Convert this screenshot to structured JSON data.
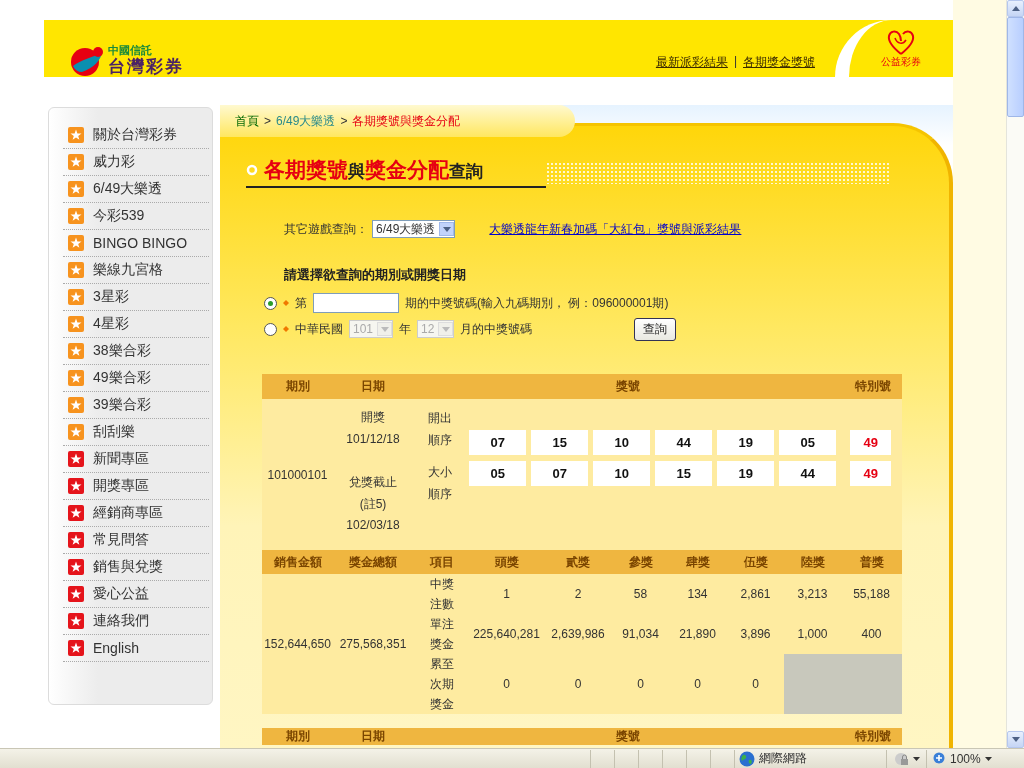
{
  "header": {
    "brand_top": "中國信託",
    "brand": "台灣彩券",
    "links": [
      "最新派彩結果",
      "各期獎金獎號"
    ],
    "link_separator": "|",
    "charity_label": "公益彩券"
  },
  "sidebar": {
    "items": [
      {
        "label": "關於台灣彩券",
        "color": "#f7931e"
      },
      {
        "label": "威力彩",
        "color": "#f7931e"
      },
      {
        "label": "6/49大樂透",
        "color": "#f7931e"
      },
      {
        "label": "今彩539",
        "color": "#f7931e"
      },
      {
        "label": "BINGO BINGO",
        "color": "#f7931e"
      },
      {
        "label": "樂線九宮格",
        "color": "#f7931e"
      },
      {
        "label": "3星彩",
        "color": "#f7931e"
      },
      {
        "label": "4星彩",
        "color": "#f7931e"
      },
      {
        "label": "38樂合彩",
        "color": "#f7931e"
      },
      {
        "label": "49樂合彩",
        "color": "#f7931e"
      },
      {
        "label": "39樂合彩",
        "color": "#f7931e"
      },
      {
        "label": "刮刮樂",
        "color": "#f7931e"
      },
      {
        "label": "新聞專區",
        "color": "#e5141b"
      },
      {
        "label": "開獎專區",
        "color": "#e5141b"
      },
      {
        "label": "經銷商專區",
        "color": "#e5141b"
      },
      {
        "label": "常見問答",
        "color": "#e5141b"
      },
      {
        "label": "銷售與兌獎",
        "color": "#e5141b"
      },
      {
        "label": "愛心公益",
        "color": "#e5141b"
      },
      {
        "label": "連絡我們",
        "color": "#e5141b"
      },
      {
        "label": "English",
        "color": "#e5141b"
      }
    ]
  },
  "breadcrumb": {
    "separator": ">",
    "items": [
      {
        "label": "首頁",
        "kind": "home"
      },
      {
        "label": "6/49大樂透",
        "kind": "link"
      },
      {
        "label": "各期獎號與獎金分配",
        "kind": "current"
      }
    ]
  },
  "title": [
    {
      "text": "各期獎號",
      "highlight": true
    },
    {
      "text": "與",
      "highlight": false
    },
    {
      "text": "獎金分配",
      "highlight": true
    },
    {
      "text": "查詢",
      "highlight": false
    }
  ],
  "game_select": {
    "label": "其它遊戲查詢：",
    "value": "6/49大樂透"
  },
  "promo_link": "大樂透龍年新春加碼「大紅包」獎號與派彩結果",
  "query": {
    "heading": "請選擇欲查詢的期別或開獎日期",
    "options": [
      {
        "kind": "period",
        "selected": true,
        "prefix": "第",
        "suffix": "期的中獎號碼(輸入九碼期別， 例：096000001期)"
      },
      {
        "kind": "date",
        "selected": false,
        "prefix": "中華民國",
        "year": "101",
        "year_unit": "年",
        "month": "12",
        "month_unit": "月的中獎號碼",
        "disabled": true
      }
    ],
    "submit": "查詢"
  },
  "draw_table": {
    "columns": [
      "期別",
      "日期",
      "獎號",
      "特別號"
    ],
    "period": "101000101",
    "draw_label": "開獎",
    "draw_date": "101/12/18",
    "deadline_label": "兌獎截止",
    "deadline_note": "(註5)",
    "deadline_date": "102/03/18",
    "rows": [
      {
        "label": "開出順序",
        "numbers": [
          "07",
          "15",
          "10",
          "44",
          "19",
          "05"
        ],
        "special": "49"
      },
      {
        "label": "大小順序",
        "numbers": [
          "05",
          "07",
          "10",
          "15",
          "19",
          "44"
        ],
        "special": "49"
      }
    ]
  },
  "prize_table": {
    "columns": [
      "銷售金額",
      "獎金總額",
      "項目",
      "頭獎",
      "貳獎",
      "參獎",
      "肆獎",
      "伍獎",
      "陸獎",
      "普獎"
    ],
    "rows": [
      {
        "cells": [
          {
            "kind": "value",
            "text": "152,644,650",
            "rowspan": 3
          },
          {
            "kind": "value",
            "text": "275,568,351",
            "rowspan": 3
          },
          {
            "kind": "label",
            "text": "中獎注數"
          },
          {
            "kind": "value",
            "text": "1"
          },
          {
            "kind": "value",
            "text": "2"
          },
          {
            "kind": "value",
            "text": "58"
          },
          {
            "kind": "value",
            "text": "134"
          },
          {
            "kind": "value",
            "text": "2,861"
          },
          {
            "kind": "value",
            "text": "3,213"
          },
          {
            "kind": "value",
            "text": "55,188"
          }
        ]
      },
      {
        "cells": [
          {
            "kind": "label",
            "text": "單注獎金"
          },
          {
            "kind": "value",
            "text": "225,640,281"
          },
          {
            "kind": "value",
            "text": "2,639,986"
          },
          {
            "kind": "value",
            "text": "91,034"
          },
          {
            "kind": "value",
            "text": "21,890"
          },
          {
            "kind": "value",
            "text": "3,896"
          },
          {
            "kind": "value",
            "text": "1,000"
          },
          {
            "kind": "value",
            "text": "400"
          }
        ]
      },
      {
        "cells": [
          {
            "kind": "label",
            "text": "累至次期獎金"
          },
          {
            "kind": "value",
            "text": "0"
          },
          {
            "kind": "value",
            "text": "0"
          },
          {
            "kind": "value",
            "text": "0"
          },
          {
            "kind": "value",
            "text": "0"
          },
          {
            "kind": "value",
            "text": "0"
          },
          {
            "kind": "blank"
          },
          {
            "kind": "blank"
          }
        ]
      }
    ]
  },
  "next_table": {
    "columns": [
      "期別",
      "日期",
      "獎號",
      "特別號"
    ]
  },
  "status_bar": {
    "zone": "網際網路",
    "zoom": "100%"
  }
}
